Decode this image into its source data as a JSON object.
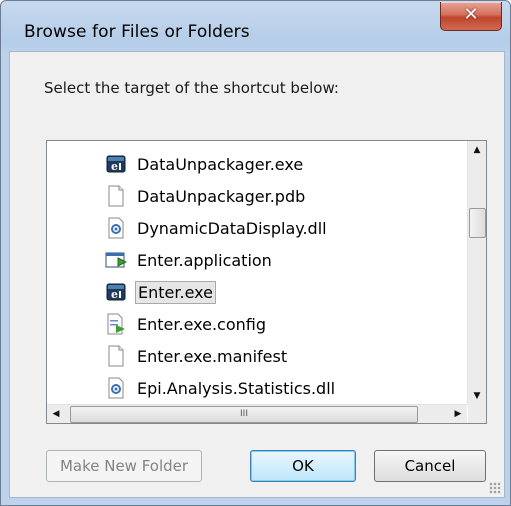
{
  "window": {
    "title": "Browse for Files or Folders"
  },
  "dialog": {
    "prompt": "Select the target of the shortcut below:",
    "items": [
      {
        "label": "DataUnpackager.exe",
        "icon": "exe-icon",
        "selected": false
      },
      {
        "label": "DataUnpackager.pdb",
        "icon": "file-icon",
        "selected": false
      },
      {
        "label": "DynamicDataDisplay.dll",
        "icon": "dll-icon",
        "selected": false
      },
      {
        "label": "Enter.application",
        "icon": "application-icon",
        "selected": false
      },
      {
        "label": "Enter.exe",
        "icon": "exe-icon",
        "selected": true
      },
      {
        "label": "Enter.exe.config",
        "icon": "config-icon",
        "selected": false
      },
      {
        "label": "Enter.exe.manifest",
        "icon": "file-icon",
        "selected": false
      },
      {
        "label": "Epi.Analysis.Statistics.dll",
        "icon": "dll-icon",
        "selected": false
      }
    ],
    "hscroll_grip": "III"
  },
  "buttons": {
    "make_new_folder": "Make New Folder",
    "ok": "OK",
    "cancel": "Cancel"
  },
  "colors": {
    "titlebar": "#c6d9ef",
    "close": "#c0452d",
    "selection": "#e6e6e6"
  }
}
